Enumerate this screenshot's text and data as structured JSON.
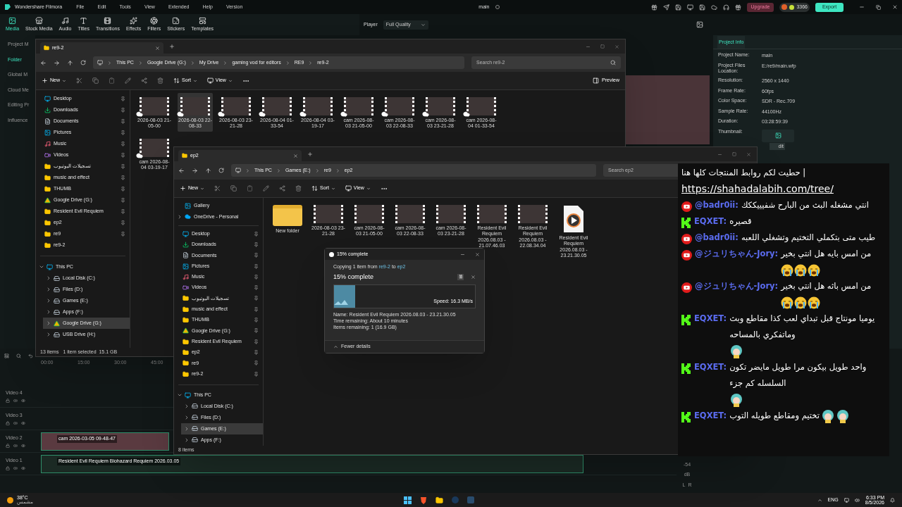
{
  "app": {
    "name": "Wondershare Filmora",
    "menu": [
      "File",
      "Edit",
      "Tools",
      "View",
      "Extended",
      "Help",
      "Version"
    ],
    "project_title": "main",
    "upgrade": "Upgrade",
    "credits": "3366",
    "export": "Export"
  },
  "media_tabs": [
    {
      "label": "Media",
      "selected": true
    },
    {
      "label": "Stock Media",
      "selected": false
    },
    {
      "label": "Audio",
      "selected": false
    },
    {
      "label": "Titles",
      "selected": false
    },
    {
      "label": "Transitions",
      "selected": false
    },
    {
      "label": "Effects",
      "selected": false
    },
    {
      "label": "Filters",
      "selected": false
    },
    {
      "label": "Stickers",
      "selected": false
    },
    {
      "label": "Templates",
      "selected": false
    }
  ],
  "player": {
    "label": "Player",
    "quality": "Full Quality"
  },
  "sidebar": [
    {
      "label": "Project M",
      "selected": false
    },
    {
      "label": "Folder",
      "selected": true
    },
    {
      "label": "Global M",
      "selected": false
    },
    {
      "label": "Cloud Me",
      "selected": false
    },
    {
      "label": "Editing Pr",
      "selected": false
    },
    {
      "label": "Influence",
      "selected": false
    }
  ],
  "project_info": {
    "tab": "Project Info",
    "fields": [
      {
        "label": "Project Name:",
        "value": "main"
      },
      {
        "label": "Project Files Location:",
        "value": "E:/re9/main.wfp"
      },
      {
        "label": "Resolution:",
        "value": "2560 x 1440"
      },
      {
        "label": "Frame Rate:",
        "value": "60fps"
      },
      {
        "label": "Color Space:",
        "value": "SDR - Rec.709"
      },
      {
        "label": "Sample Rate:",
        "value": "44100Hz"
      },
      {
        "label": "Duration:",
        "value": "03:28:59:39"
      },
      {
        "label": "Thumbnail:"
      }
    ],
    "edit_button": "dit"
  },
  "explorer_windows": [
    {
      "tab": "re9-2",
      "path": [
        "This PC",
        "Google Drive (G:)",
        "My Drive",
        "gaming vod for editors",
        "RE9",
        "re9-2"
      ],
      "search": "Search re9-2",
      "toolbar": {
        "new": "New",
        "sort": "Sort",
        "view": "View"
      },
      "preview": "Preview",
      "nav": [
        {
          "label": "Desktop",
          "kind": "desktop",
          "pinned": true
        },
        {
          "label": "Downloads",
          "kind": "downloads",
          "pinned": true
        },
        {
          "label": "Documents",
          "kind": "documents",
          "pinned": true
        },
        {
          "label": "Pictures",
          "kind": "pictures",
          "pinned": true
        },
        {
          "label": "Music",
          "kind": "music",
          "pinned": true
        },
        {
          "label": "Videos",
          "kind": "videos",
          "pinned": true
        },
        {
          "label": "تسجيلات اليوتيوب",
          "kind": "folder",
          "pinned": true
        },
        {
          "label": "music and effect",
          "kind": "folder",
          "pinned": true
        },
        {
          "label": "THUMB",
          "kind": "folder",
          "pinned": true
        },
        {
          "label": "Google Drive (G:)",
          "kind": "gdrive",
          "pinned": true
        },
        {
          "label": "Resident Evil Requiem",
          "kind": "folder",
          "pinned": true
        },
        {
          "label": "ep2",
          "kind": "folder",
          "pinned": true
        },
        {
          "label": "re9",
          "kind": "folder",
          "pinned": true
        },
        {
          "label": "re9-2",
          "kind": "folder",
          "pinned": false
        }
      ],
      "this_pc": {
        "label": "This PC",
        "expanded": true,
        "children": [
          {
            "label": "Local Disk (C:)",
            "kind": "disk",
            "selected": false
          },
          {
            "label": "Files (D:)",
            "kind": "disk",
            "selected": false
          },
          {
            "label": "Games (E:)",
            "kind": "disk",
            "selected": false
          },
          {
            "label": "Apps (F:)",
            "kind": "disk",
            "selected": false
          },
          {
            "label": "Google Drive (G:)",
            "kind": "gdrive",
            "selected": true
          },
          {
            "label": "USB Drive (H:)",
            "kind": "disk",
            "selected": false
          }
        ]
      },
      "items": [
        {
          "label": "2026-08-03 21-05-00",
          "kind": "video",
          "cloud": true,
          "selected": false
        },
        {
          "label": "2026-08-03 22-08-33",
          "kind": "video",
          "cloud": true,
          "selected": true
        },
        {
          "label": "2026-08-03 23-21-28",
          "kind": "video",
          "cloud": true,
          "selected": false
        },
        {
          "label": "2026-08-04 01-33-54",
          "kind": "video",
          "cloud": true,
          "selected": false
        },
        {
          "label": "2026-08-04 03-19-17",
          "kind": "video",
          "cloud": true,
          "selected": false
        },
        {
          "label": "cam 2026-08-03 21-05-00",
          "kind": "video",
          "cloud": true,
          "selected": false
        },
        {
          "label": "cam 2026-08-03 22-08-33",
          "kind": "video",
          "cloud": true,
          "selected": false
        },
        {
          "label": "cam 2026-08-03 23-21-28",
          "kind": "video",
          "cloud": true,
          "selected": false
        },
        {
          "label": "cam 2026-08-04 01-33-54",
          "kind": "video",
          "cloud": true,
          "selected": false
        },
        {
          "label": "cam 2026-08-04 03-19-17",
          "kind": "video",
          "cloud": true,
          "selected": false
        }
      ],
      "status": [
        "13 items",
        "1 item selected  15.1 GB"
      ]
    },
    {
      "tab": "ep2",
      "path": [
        "This PC",
        "Games (E:)",
        "re9",
        "ep2"
      ],
      "search": "Search ep2",
      "toolbar": {
        "new": "New",
        "sort": "Sort",
        "view": "View"
      },
      "nav_top": [
        {
          "label": "Gallery",
          "kind": "gallery"
        },
        {
          "label": "OneDrive - Personal",
          "kind": "onedrive"
        }
      ],
      "nav": [
        {
          "label": "Desktop",
          "kind": "desktop",
          "pinned": true
        },
        {
          "label": "Downloads",
          "kind": "downloads",
          "pinned": true
        },
        {
          "label": "Documents",
          "kind": "documents",
          "pinned": true
        },
        {
          "label": "Pictures",
          "kind": "pictures",
          "pinned": true
        },
        {
          "label": "Music",
          "kind": "music",
          "pinned": true
        },
        {
          "label": "Videos",
          "kind": "videos",
          "pinned": true
        },
        {
          "label": "تسجيلات اليوتيوب",
          "kind": "folder",
          "pinned": true
        },
        {
          "label": "music and effect",
          "kind": "folder",
          "pinned": true
        },
        {
          "label": "THUMB",
          "kind": "folder",
          "pinned": true
        },
        {
          "label": "Google Drive (G:)",
          "kind": "gdrive",
          "pinned": true
        },
        {
          "label": "Resident Evil Requiem",
          "kind": "folder",
          "pinned": true
        },
        {
          "label": "ep2",
          "kind": "folder",
          "pinned": true
        },
        {
          "label": "re9",
          "kind": "folder",
          "pinned": true
        },
        {
          "label": "re9-2",
          "kind": "folder",
          "pinned": true
        }
      ],
      "this_pc": {
        "label": "This PC",
        "expanded": true,
        "children": [
          {
            "label": "Local Disk (C:)",
            "kind": "disk",
            "selected": false
          },
          {
            "label": "Files (D:)",
            "kind": "disk",
            "selected": false
          },
          {
            "label": "Games (E:)",
            "kind": "disk",
            "selected": true
          },
          {
            "label": "Apps (F:)",
            "kind": "disk",
            "selected": false
          }
        ]
      },
      "items": [
        {
          "label": "New folder",
          "kind": "folder",
          "cloud": false,
          "selected": false
        },
        {
          "label": "2026-08-03 23-21-28",
          "kind": "video",
          "cloud": false,
          "selected": false
        },
        {
          "label": "cam 2026-08-03 21-05-00",
          "kind": "video",
          "cloud": false,
          "selected": false
        },
        {
          "label": "cam 2026-08-03 22-08-33",
          "kind": "video",
          "cloud": false,
          "selected": false
        },
        {
          "label": "cam 2026-08-03 23-21-28",
          "kind": "video",
          "cloud": false,
          "selected": false
        },
        {
          "label": "Resident Evil Requiem 2026.08.03 - 21.07.46.03",
          "kind": "video",
          "cloud": false,
          "selected": false
        },
        {
          "label": "Resident Evil Requiem 2026.08.03 - 22.08.34.04",
          "kind": "video",
          "cloud": false,
          "selected": false
        },
        {
          "label": "Resident Evil Requiem 2026.08.03 - 23.21.30.05",
          "kind": "media_file",
          "cloud": false,
          "selected": false
        }
      ],
      "status": [
        "8 items"
      ]
    }
  ],
  "copy_dialog": {
    "title": "15% complete",
    "copying_prefix": "Copying 1 item from",
    "source": "re9-2",
    "joiner": "to",
    "destination": "ep2",
    "progress_text": "15% complete",
    "level": 0.15,
    "speed": "Speed: 16.3 MB/s",
    "details": [
      {
        "label": "Name:",
        "value": "Resident Evil Requiem 2026.08.03 - 23.21.30.05"
      },
      {
        "label": "Time remaining:",
        "value": "About 10 minutes"
      },
      {
        "label": "Items remaining:",
        "value": "1 (16.9 GB)"
      }
    ],
    "toggle": "Fewer details"
  },
  "chat": {
    "header_text": "حطيت لكم روابط المنتجات كلها هنا |",
    "link": "https://shahadalabih.com/tree/",
    "messages": [
      {
        "kind": "youtube",
        "user": "@badr0ii:",
        "text": "انتي مشغله البث من البارح شفيييككك"
      },
      {
        "kind": "kick",
        "user": "EQXET:",
        "text": "قصيره"
      },
      {
        "kind": "youtube",
        "user": "@badr0ii:",
        "text": "طيب متى بتكملي التختيم وتشغلي اللعبه"
      },
      {
        "kind": "youtube",
        "user": "@ジュリちゃん-Jory:",
        "text": "من امس بايه هل انتي بخير",
        "emotes": [
          {
            "kind": "crying"
          },
          {
            "kind": "crying"
          },
          {
            "kind": "crying"
          }
        ]
      },
      {
        "kind": "youtube",
        "user": "@ジュリちゃん-Jory:",
        "text": "من امس باثه هل انتي بخير",
        "emotes": [
          {
            "kind": "crying"
          },
          {
            "kind": "crying"
          },
          {
            "kind": "crying"
          }
        ]
      },
      {
        "kind": "kick",
        "user": "EQXET:",
        "text": "يوميا مونتاج قبل تبداي لعب كذا مقاطع وبث وماتفكري بالمساحه",
        "emotes": [
          {
            "kind": "sticker"
          }
        ]
      },
      {
        "kind": "kick",
        "user": "EQXET:",
        "text": "واحد طويل بيكون مرا طويل مايضر تكون السلسله كم جزء",
        "emotes": [
          {
            "kind": "sticker"
          }
        ]
      },
      {
        "kind": "kick",
        "user": "EQXET:",
        "text": "تختيم ومقاطع طويله التوب",
        "emotes": [
          {
            "kind": "sticker"
          },
          {
            "kind": "sticker"
          }
        ]
      }
    ]
  },
  "timeline": {
    "ruler": [
      "00:00",
      "15:00",
      "30:00",
      "45:00"
    ],
    "tracks": [
      {
        "label": "Video 4"
      },
      {
        "label": "Video 3"
      },
      {
        "label": "Video 2",
        "clip": "cam 2026-03-05 09-48-47"
      },
      {
        "label": "Video 1",
        "clip": "Resident Evil Requiem Biohazard Requiem 2026.03.05"
      }
    ],
    "meter": {
      "scale": "-54",
      "unit": "dB",
      "channels": [
        "L",
        "R"
      ]
    }
  },
  "taskbar": {
    "temperature": "38°C",
    "weather": "مشمس",
    "language": "ENG",
    "time": "6:33 PM",
    "date": "8/5/2026"
  }
}
